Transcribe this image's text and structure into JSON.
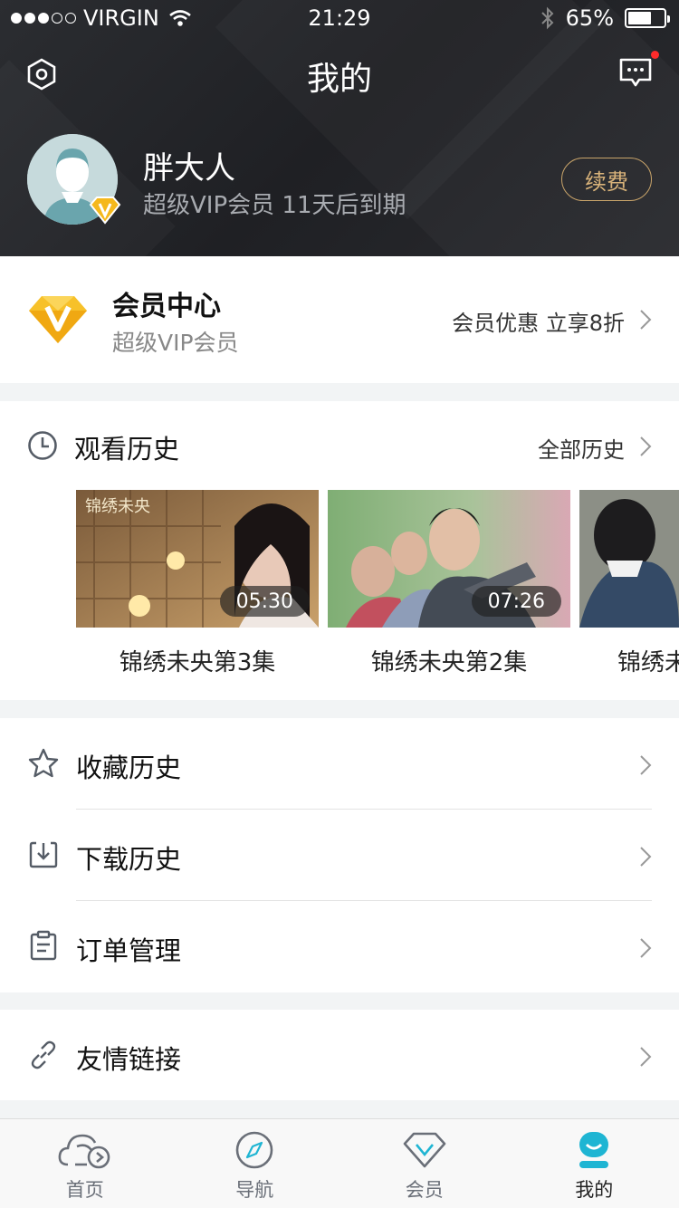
{
  "status_bar": {
    "carrier": "VIRGIN",
    "time": "21:29",
    "battery": "65%",
    "battery_level": 0.65
  },
  "header": {
    "title": "我的"
  },
  "profile": {
    "name": "胖大人",
    "vip_info": "超级VIP会员  11天后到期",
    "renew_label": "续费"
  },
  "member_center": {
    "title": "会员中心",
    "subtitle": "超级VIP会员",
    "promo": "会员优惠  立享8折"
  },
  "history": {
    "title": "观看历史",
    "all_label": "全部历史",
    "items": [
      {
        "caption": "锦绣未央第3集",
        "duration": "05:30",
        "overlay": "锦绣未央"
      },
      {
        "caption": "锦绣未央第2集",
        "duration": "07:26"
      },
      {
        "caption": "锦绣未"
      }
    ]
  },
  "menu": [
    {
      "label": "收藏历史",
      "icon": "star-icon"
    },
    {
      "label": "下载历史",
      "icon": "download-icon"
    },
    {
      "label": "订单管理",
      "icon": "clipboard-icon"
    }
  ],
  "links": {
    "label": "友情链接",
    "icon": "link-icon"
  },
  "tabbar": {
    "items": [
      {
        "label": "首页",
        "icon": "home-cloud-icon"
      },
      {
        "label": "导航",
        "icon": "compass-icon"
      },
      {
        "label": "会员",
        "icon": "diamond-icon"
      },
      {
        "label": "我的",
        "icon": "profile-face-icon",
        "active": true
      }
    ]
  },
  "colors": {
    "header_bg": "#26272b",
    "accent_gold": "#f5b81c",
    "active_tab": "#1fb5d3",
    "red_dot": "#ff2b2b"
  }
}
